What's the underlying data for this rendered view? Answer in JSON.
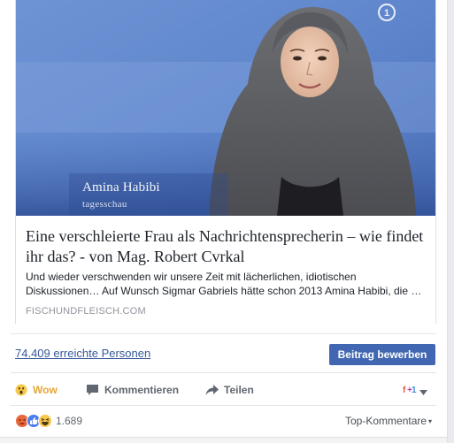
{
  "link_preview": {
    "image_caption_name": "Amina Habibi",
    "image_caption_show": "tagesschau",
    "title": "Eine verschleierte Frau als Nachrichtensprecherin – wie findet ihr das? - von Mag. Robert Cvrkal",
    "description": "Und wieder verschwenden wir unsere Zeit mit lächerlichen, idiotischen Diskussionen… Auf Wunsch Sigmar Gabriels hätte schon 2013 Amina Habibi, die …",
    "domain": "FISCHUNDFLEISCH.COM"
  },
  "insights": {
    "reach_text": "74.409 erreichte Personen",
    "boost_label": "Beitrag bewerben"
  },
  "actions": {
    "wow_label": "Wow",
    "comment_label": "Kommentieren",
    "share_label": "Teilen",
    "language_icon": "translate-icon"
  },
  "reactions": {
    "count": "1.689",
    "icons": [
      "angry-reaction-icon",
      "like-reaction-icon",
      "haha-reaction-icon"
    ],
    "sort_label": "Top-Kommentare"
  },
  "colors": {
    "link": "#365899",
    "button": "#4267b2",
    "wow": "#e6a63a",
    "muted": "#90949c"
  }
}
